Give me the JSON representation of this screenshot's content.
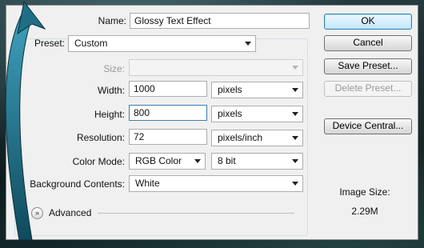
{
  "dialog": {
    "name_label": "Name:",
    "name_value": "Glossy Text Effect",
    "preset_label": "Preset:",
    "preset_value": "Custom",
    "size_label": "Size:",
    "size_value": "",
    "width_label": "Width:",
    "width_value": "1000",
    "width_unit": "pixels",
    "height_label": "Height:",
    "height_value": "800",
    "height_unit": "pixels",
    "resolution_label": "Resolution:",
    "resolution_value": "72",
    "resolution_unit": "pixels/inch",
    "color_mode_label": "Color Mode:",
    "color_mode_value": "RGB Color",
    "bit_depth_value": "8 bit",
    "background_label": "Background Contents:",
    "background_value": "White",
    "advanced_label": "Advanced"
  },
  "buttons": {
    "ok": "OK",
    "cancel": "Cancel",
    "save_preset": "Save Preset...",
    "delete_preset": "Delete Preset...",
    "device_central": "Device Central..."
  },
  "info": {
    "image_size_label": "Image Size:",
    "image_size_value": "2.29M"
  },
  "overlay": {
    "arrow_color": "#1e6f86"
  }
}
